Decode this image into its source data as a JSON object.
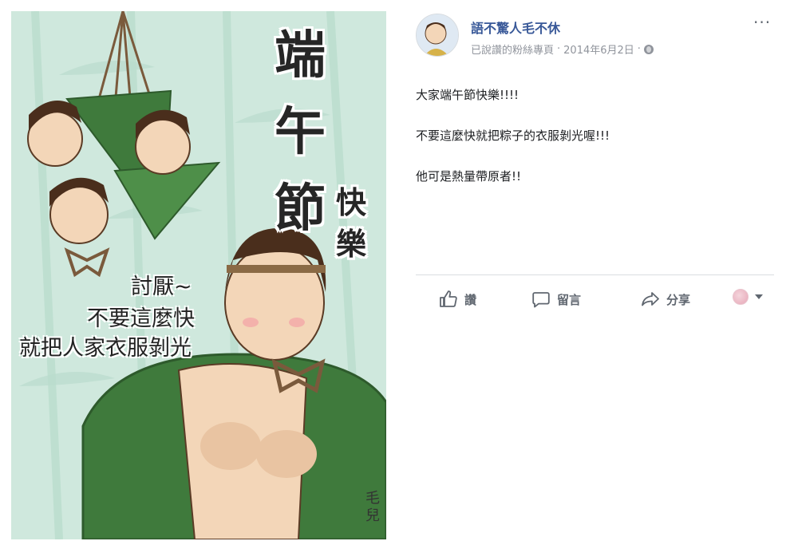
{
  "illustration": {
    "title_main": [
      "端",
      "午",
      "節"
    ],
    "title_sub": [
      "快",
      "樂"
    ],
    "speech_lines": [
      "討厭~",
      "不要這麼快",
      "就把人家衣服剝光"
    ],
    "signature": [
      "毛",
      "兒"
    ]
  },
  "post": {
    "page_name": "語不驚人毛不休",
    "subtitle": "已說讚的粉絲專頁",
    "separator": "·",
    "timestamp": "2014年6月2日",
    "more_label": "···",
    "lines": [
      "大家端午節快樂!!!!",
      "不要這麼快就把粽子的衣服剝光喔!!!",
      "他可是熱量帶原者!!"
    ],
    "actions": {
      "like": "讚",
      "comment": "留言",
      "share": "分享"
    }
  },
  "colors": {
    "link_blue": "#385898",
    "muted_gray": "#90949c",
    "action_gray": "#606770",
    "art_background": "#cfe8dd",
    "leaf_green": "#3f7a3c"
  },
  "icons": {
    "more": "more-horizontal-icon",
    "privacy": "globe-icon",
    "like": "thumbs-up-icon",
    "comment": "comment-bubble-icon",
    "share": "share-arrow-icon",
    "reaction": "reaction-selector-icon"
  }
}
